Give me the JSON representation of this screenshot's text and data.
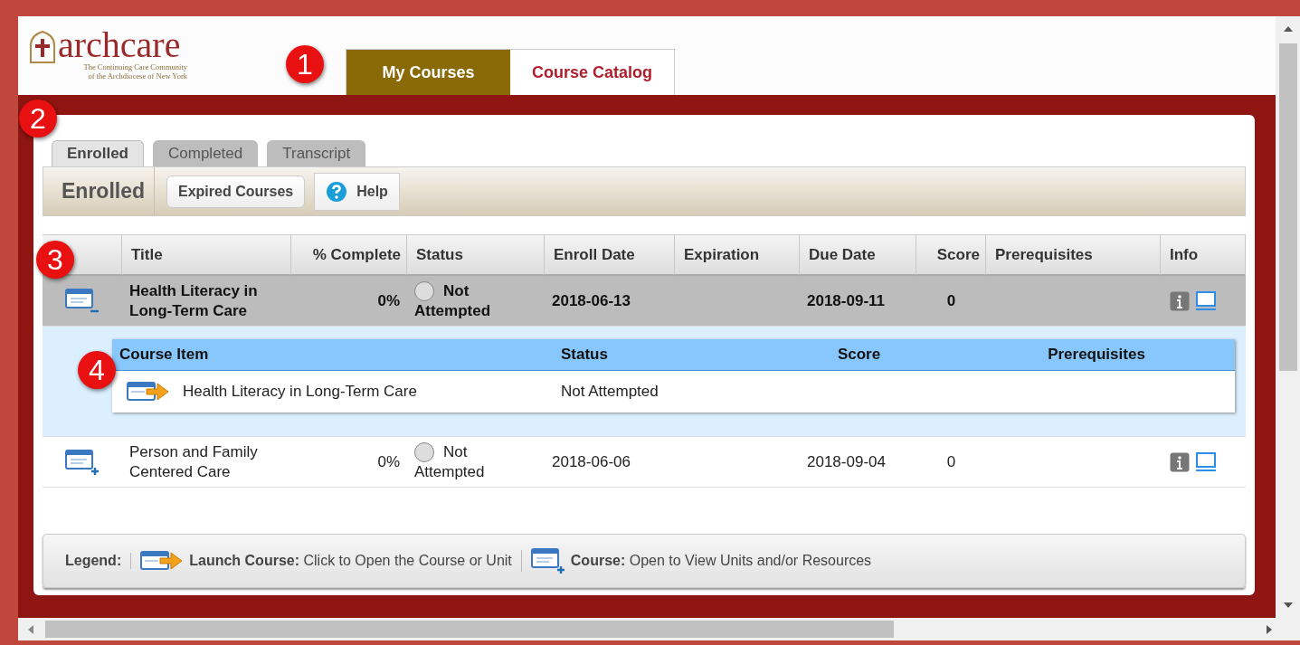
{
  "logo": {
    "name": "archcare",
    "tagline": [
      "The Continuing Care Community",
      "of the Archdiocese of New York"
    ]
  },
  "main_tabs": [
    {
      "label": "My Courses",
      "selected": true
    },
    {
      "label": "Course Catalog",
      "selected": false
    }
  ],
  "sub_tabs": [
    {
      "label": "Enrolled",
      "selected": true
    },
    {
      "label": "Completed",
      "selected": false
    },
    {
      "label": "Transcript",
      "selected": false
    }
  ],
  "toolbar": {
    "title": "Enrolled",
    "buttons": [
      {
        "label": "Expired Courses",
        "kind": "plain"
      },
      {
        "label": "Help",
        "kind": "help"
      }
    ]
  },
  "table": {
    "columns": [
      "Title",
      "% Complete",
      "Status",
      "Enroll Date",
      "Expiration",
      "Due Date",
      "Score",
      "Prerequisites",
      "Info"
    ],
    "rows": [
      {
        "expanded": true,
        "title": "Health Literacy in Long-Term Care",
        "complete": "0%",
        "status": "Not Attempted",
        "enroll_date": "2018-06-13",
        "due_date": "2018-09-11",
        "score": "0",
        "items": {
          "columns": [
            "Course Item",
            "Status",
            "Score",
            "Prerequisites"
          ],
          "rows": [
            {
              "title": "Health Literacy in Long-Term Care",
              "status": "Not Attempted"
            }
          ]
        }
      },
      {
        "expanded": false,
        "title": "Person and Family Centered Care",
        "complete": "0%",
        "status": "Not Attempted",
        "enroll_date": "2018-06-06",
        "due_date": "2018-09-04",
        "score": "0"
      }
    ]
  },
  "legend": {
    "label": "Legend:",
    "items": [
      {
        "kind": "launch",
        "term": "Launch Course:",
        "text": "Click to Open the Course or Unit"
      },
      {
        "kind": "course",
        "term": "Course:",
        "text": "Open to View Units and/or Resources"
      }
    ]
  },
  "callouts": [
    "1",
    "2",
    "3",
    "4"
  ]
}
